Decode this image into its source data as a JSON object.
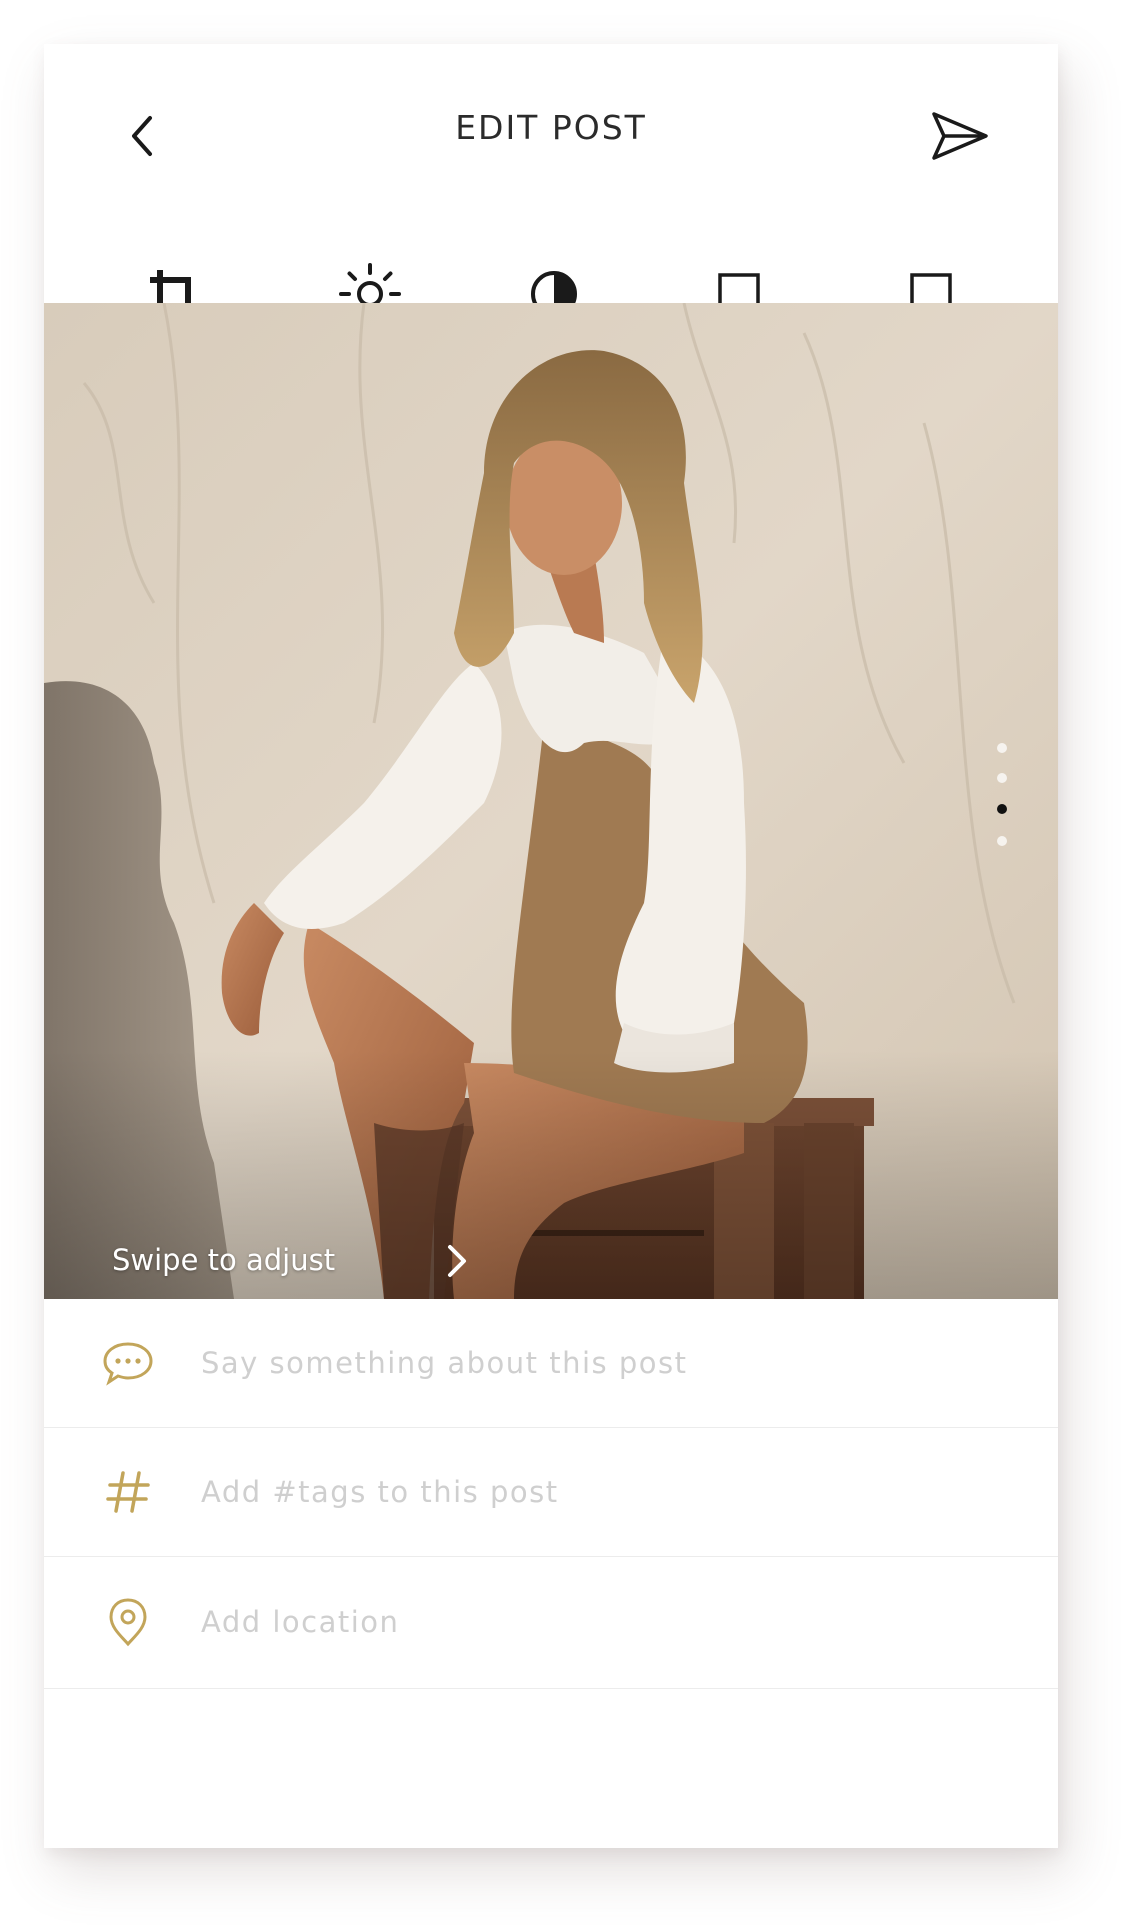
{
  "header": {
    "title": "EDIT POST",
    "back_icon": "chevron-left-icon",
    "send_icon": "send-icon"
  },
  "toolbar": {
    "tools": [
      {
        "icon": "crop-icon"
      },
      {
        "icon": "brightness-icon"
      },
      {
        "icon": "contrast-icon"
      },
      {
        "icon": "square-icon"
      },
      {
        "icon": "square-icon"
      }
    ]
  },
  "photo": {
    "overlay_text": "Swipe to adjust",
    "page_dots": 4,
    "active_dot": 3
  },
  "fields": {
    "caption_placeholder": "Say something about this post",
    "tags_placeholder": "Add #tags to this post",
    "location_placeholder": "Add location"
  },
  "colors": {
    "accent": "#c2a55a",
    "text": "#2b2b2b",
    "placeholder": "#cfcfcf"
  }
}
